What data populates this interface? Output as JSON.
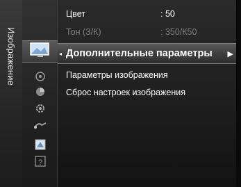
{
  "category": {
    "label": "Изображение"
  },
  "icons": [
    "picture-icon",
    "sound-icon",
    "channel-icon",
    "setup-icon",
    "input-icon",
    "application-icon",
    "support-icon"
  ],
  "menu": {
    "items": [
      {
        "label": "Цвет",
        "value": ": 50",
        "dimmed": false
      },
      {
        "label": "Тон (З/К)",
        "value": ": 350/К50",
        "dimmed": true
      },
      {
        "label": "Дополнительные параметры",
        "value": "",
        "selected": true
      },
      {
        "label": "Параметры изображения",
        "value": ""
      },
      {
        "label": "Сброс настроек изображения",
        "value": ""
      }
    ]
  }
}
